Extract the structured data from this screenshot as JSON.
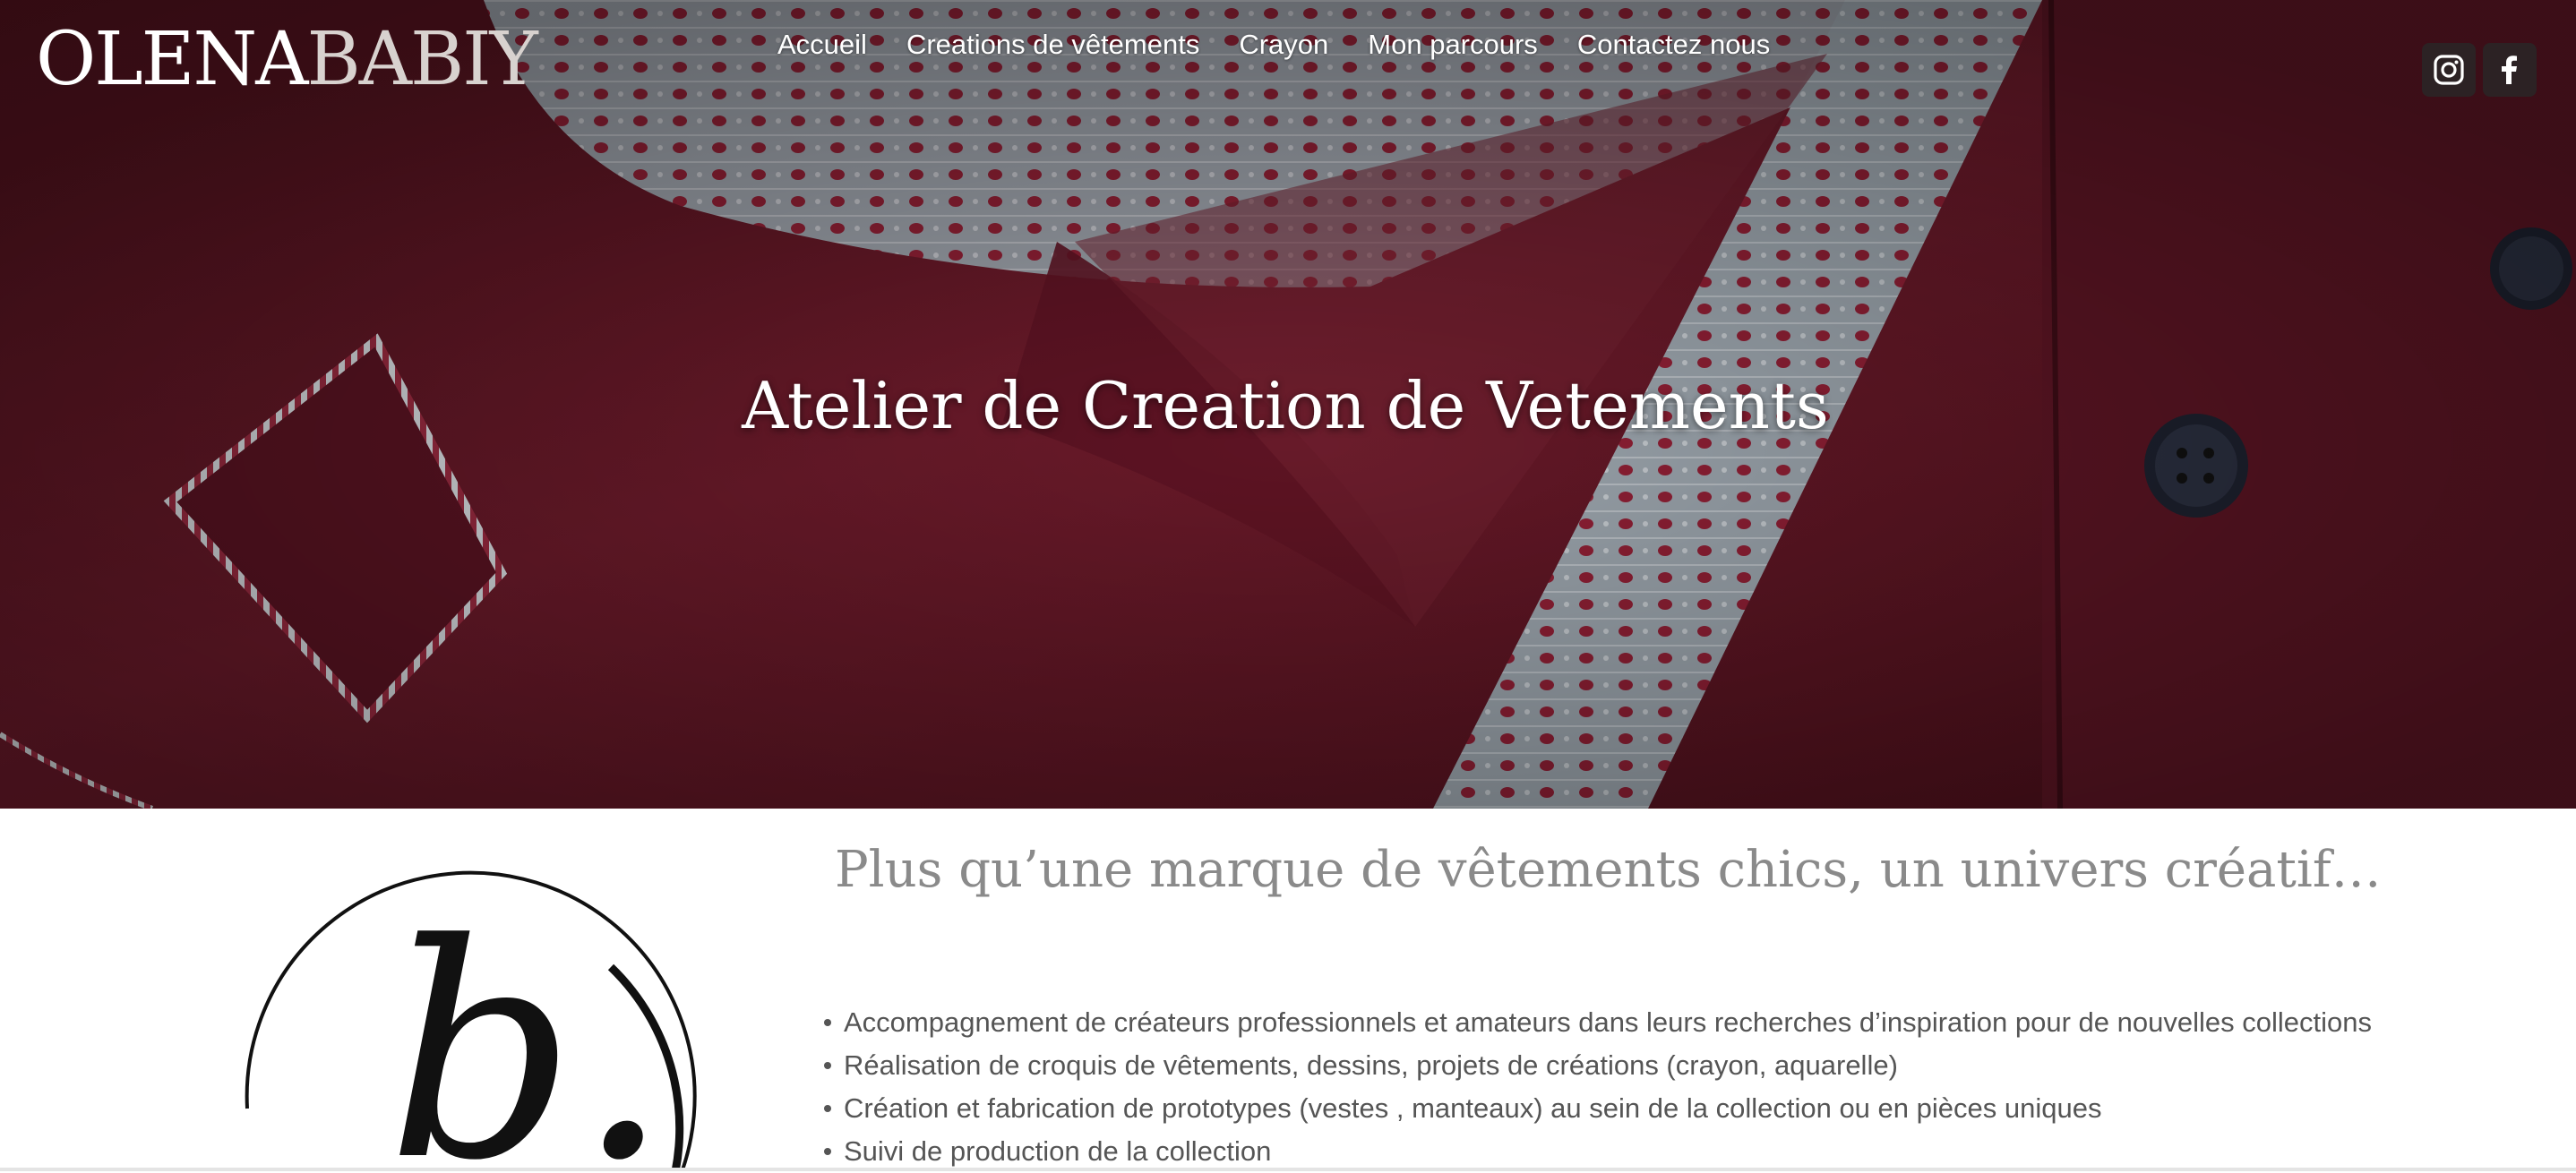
{
  "site": {
    "logo_main": "OLENA",
    "logo_light": "BABIY"
  },
  "nav": {
    "items": [
      {
        "label": "Accueil"
      },
      {
        "label": "Creations de vêtements"
      },
      {
        "label": "Crayon"
      },
      {
        "label": "Mon parcours"
      },
      {
        "label": "Contactez nous"
      }
    ]
  },
  "social": {
    "items": [
      {
        "icon": "instagram-icon"
      },
      {
        "icon": "facebook-icon"
      }
    ]
  },
  "hero": {
    "title": "Atelier de Creation de Vetements",
    "colors": {
      "fabric": "#5a1522",
      "knit_grey": "#9aa3ab",
      "knit_red": "#8e1f34"
    }
  },
  "brand_mark": {
    "glyph": "b."
  },
  "main": {
    "tagline": "Plus qu’une marque de vêtements chics, un univers créatif…",
    "services": [
      "Accompagnement de créateurs professionnels et amateurs dans leurs recherches d’inspiration pour de nouvelles collections",
      "Réalisation de croquis de vêtements, dessins, projets de créations (crayon, aquarelle)",
      "Création et fabrication de prototypes (vestes , manteaux) au sein de la collection ou en pièces uniques",
      "Suivi de production de la collection"
    ]
  }
}
